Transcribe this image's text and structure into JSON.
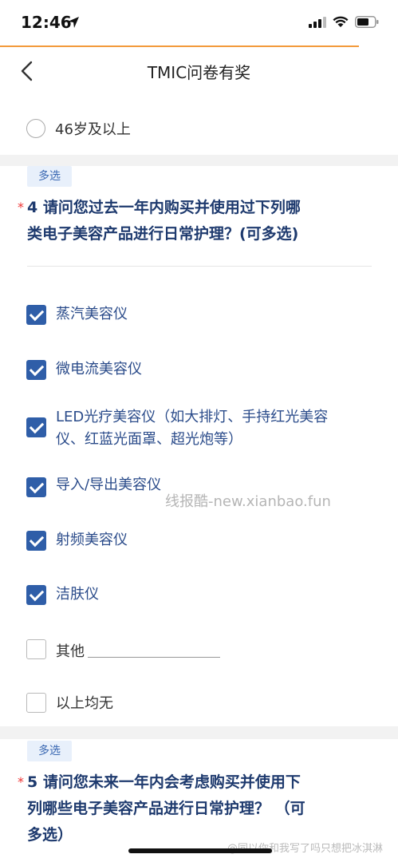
{
  "status_bar": {
    "time": "12:46"
  },
  "nav": {
    "title": "TMIC问卷有奖"
  },
  "prev_question": {
    "last_option": "46岁及以上"
  },
  "question4": {
    "tag": "多选",
    "required_mark": "*",
    "title_line1": "4 请问您过去一年内购买并使用过下列哪",
    "title_line2": "类电子美容产品进行日常护理？(可多选)",
    "options": [
      {
        "label": "蒸汽美容仪",
        "checked": true
      },
      {
        "label": "微电流美容仪",
        "checked": true
      },
      {
        "label_line1": "LED光疗美容仪（如大排灯、手持红光美容",
        "label_line2": "仪、红蓝光面罩、超光炮等）",
        "checked": true
      },
      {
        "label": "导入/导出美容仪",
        "checked": true
      },
      {
        "label": "射频美容仪",
        "checked": true
      },
      {
        "label": "洁肤仪",
        "checked": true
      },
      {
        "label": "其他",
        "checked": false
      },
      {
        "label": "以上均无",
        "checked": false
      }
    ]
  },
  "question5": {
    "tag": "多选",
    "required_mark": "*",
    "title_line1": "5 请问您未来一年内会考虑购买并使用下",
    "title_line2": "列哪些电子美容产品进行日常护理？ （可",
    "title_line3": "多选）"
  },
  "watermark": "线报酷-new.xianbao.fun",
  "weibo_watermark": "@同以你和我写了吗只想把冰淇淋"
}
